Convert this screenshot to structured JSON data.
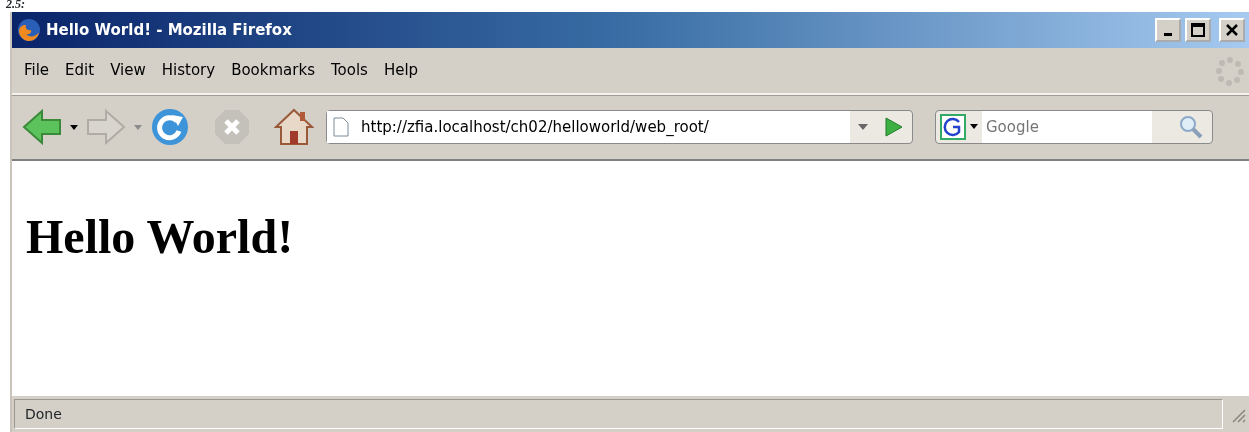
{
  "caption": "2.5:",
  "window": {
    "title": "Hello World! - Mozilla Firefox"
  },
  "menu": [
    {
      "label": "File"
    },
    {
      "label": "Edit"
    },
    {
      "label": "View"
    },
    {
      "label": "History"
    },
    {
      "label": "Bookmarks"
    },
    {
      "label": "Tools"
    },
    {
      "label": "Help"
    }
  ],
  "toolbar": {
    "back_enabled": true,
    "forward_enabled": false,
    "stop_enabled": false
  },
  "address": {
    "value": "http://zfia.localhost/ch02/helloworld/web_root/"
  },
  "search": {
    "placeholder": "Google"
  },
  "page": {
    "heading": "Hello World!"
  },
  "status_bar": {
    "text": "Done"
  }
}
